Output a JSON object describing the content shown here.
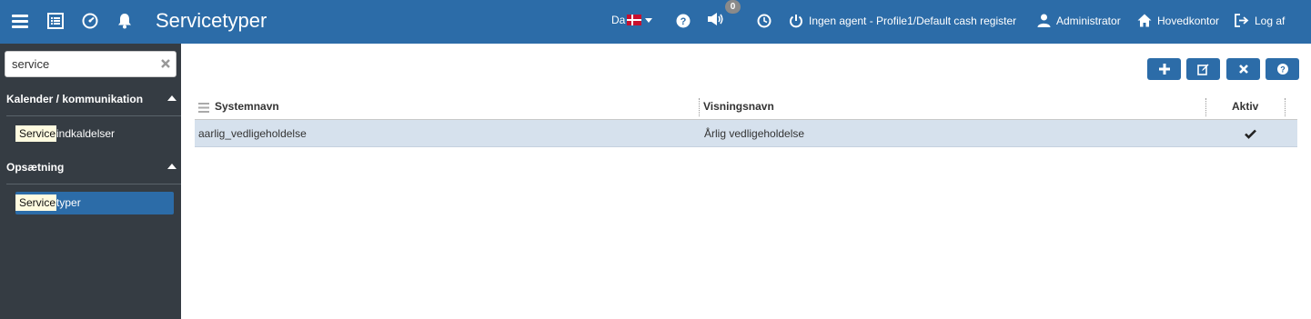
{
  "app": {
    "title": "Servicetyper",
    "colors": {
      "topbar": "#2c6ca8",
      "sidebar": "#353c43",
      "accent": "#2c6ca8",
      "row_selected": "#d6e1ed"
    }
  },
  "topbar": {
    "left_icons": [
      "menu-icon",
      "list-icon",
      "dashboard-icon",
      "bell-icon"
    ],
    "language": "Da",
    "notifications_count": "0",
    "agent_label": "Ingen agent - Profile1/Default cash register",
    "user_label": "Administrator",
    "office_label": "Hovedkontor",
    "logout_label": "Log af"
  },
  "sidebar": {
    "search": {
      "value": "service"
    },
    "sections": [
      {
        "title": "Kalender / kommunikation",
        "items": [
          {
            "highlight": "Service",
            "rest": "indkaldelser"
          }
        ]
      },
      {
        "title": "Opsætning",
        "items": [
          {
            "highlight": "Service",
            "rest": "typer",
            "active": true
          }
        ]
      }
    ]
  },
  "toolbar": {
    "buttons": [
      "add-icon",
      "edit-icon",
      "delete-icon",
      "help-icon"
    ]
  },
  "grid": {
    "columns": [
      "Systemnavn",
      "Visningsnavn",
      "Aktiv"
    ],
    "rows": [
      {
        "systemnavn": "aarlig_vedligeholdelse",
        "visningsnavn": "Årlig vedligeholdelse",
        "aktiv": true
      }
    ]
  }
}
